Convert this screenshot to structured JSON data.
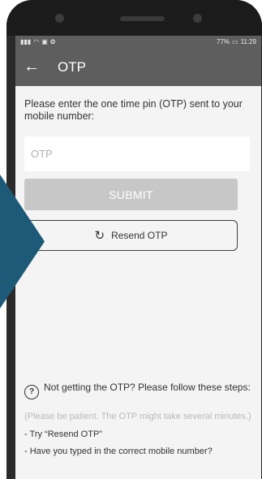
{
  "status_bar": {
    "battery": "77%",
    "time": "11:29"
  },
  "toolbar": {
    "title": "OTP"
  },
  "main": {
    "instruction": "Please enter the one time pin (OTP) sent to your mobile number:",
    "otp_placeholder": "OTP",
    "otp_value": "",
    "submit_label": "SUBMIT",
    "resend_label": "Resend OTP"
  },
  "help": {
    "heading": "Not getting the OTP? Please follow these steps:",
    "note": "(Please be patient. The OTP might take several minutes.)",
    "step1": "- Try “Resend OTP”",
    "step2": "- Have you typed in the correct mobile number?"
  },
  "colors": {
    "toolbar": "#5e5e5e",
    "submit_disabled": "#c7c7c7",
    "arrow": "#1d5a78"
  }
}
